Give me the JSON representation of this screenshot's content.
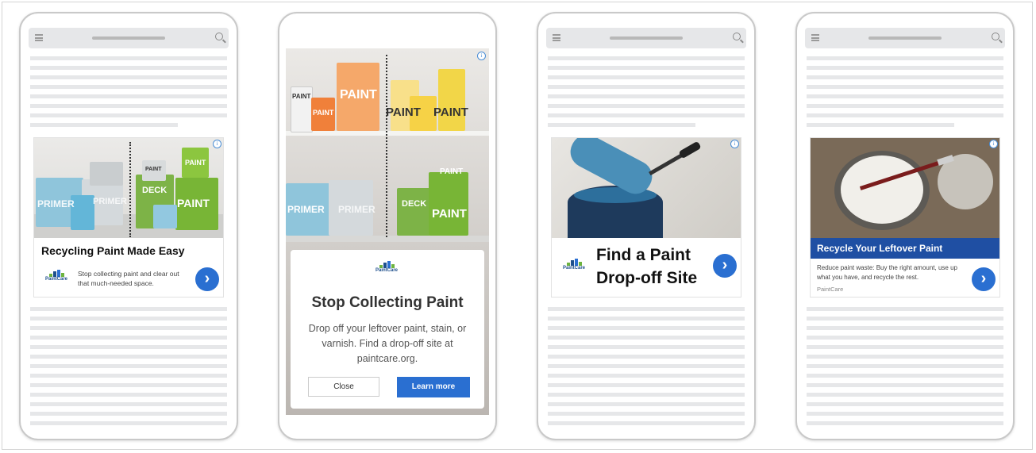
{
  "ad1": {
    "headline": "Recycling Paint Made Easy",
    "body": "Stop collecting paint and clear out that much-needed space.",
    "cta_icon": "chevron-right",
    "can_labels": [
      "PAINT",
      "PAINT",
      "DECK",
      "PRIMER",
      "PRIMER",
      "PAINT"
    ]
  },
  "ad2": {
    "headline": "Stop Collecting Paint",
    "body": "Drop off your leftover paint, stain, or varnish. Find a drop-off site at paintcare.org.",
    "close_label": "Close",
    "learn_label": "Learn more",
    "can_labels_top": [
      "PAINT",
      "PAINT",
      "PAINT",
      "PAINT",
      "PAINT"
    ],
    "can_labels_bottom": [
      "PRIMER",
      "PRIMER",
      "PAINT",
      "DECK",
      "PAINT"
    ]
  },
  "ad3": {
    "headline": "Find a Paint Drop-off Site",
    "cta_icon": "chevron-right"
  },
  "ad4": {
    "headline": "Recycle Your Leftover Paint",
    "body": "Reduce paint waste: Buy the right amount, use up what you have, and recycle the rest.",
    "advertiser": "PaintCare",
    "cta_icon": "chevron-right"
  },
  "brand": {
    "logo_text": "PaintCare",
    "accent": "#2a6fd1",
    "banner_blue": "#1f4fa3",
    "button_blue": "#2a6fd1"
  },
  "common": {
    "info_icon": "i",
    "cta_glyph": "›"
  }
}
